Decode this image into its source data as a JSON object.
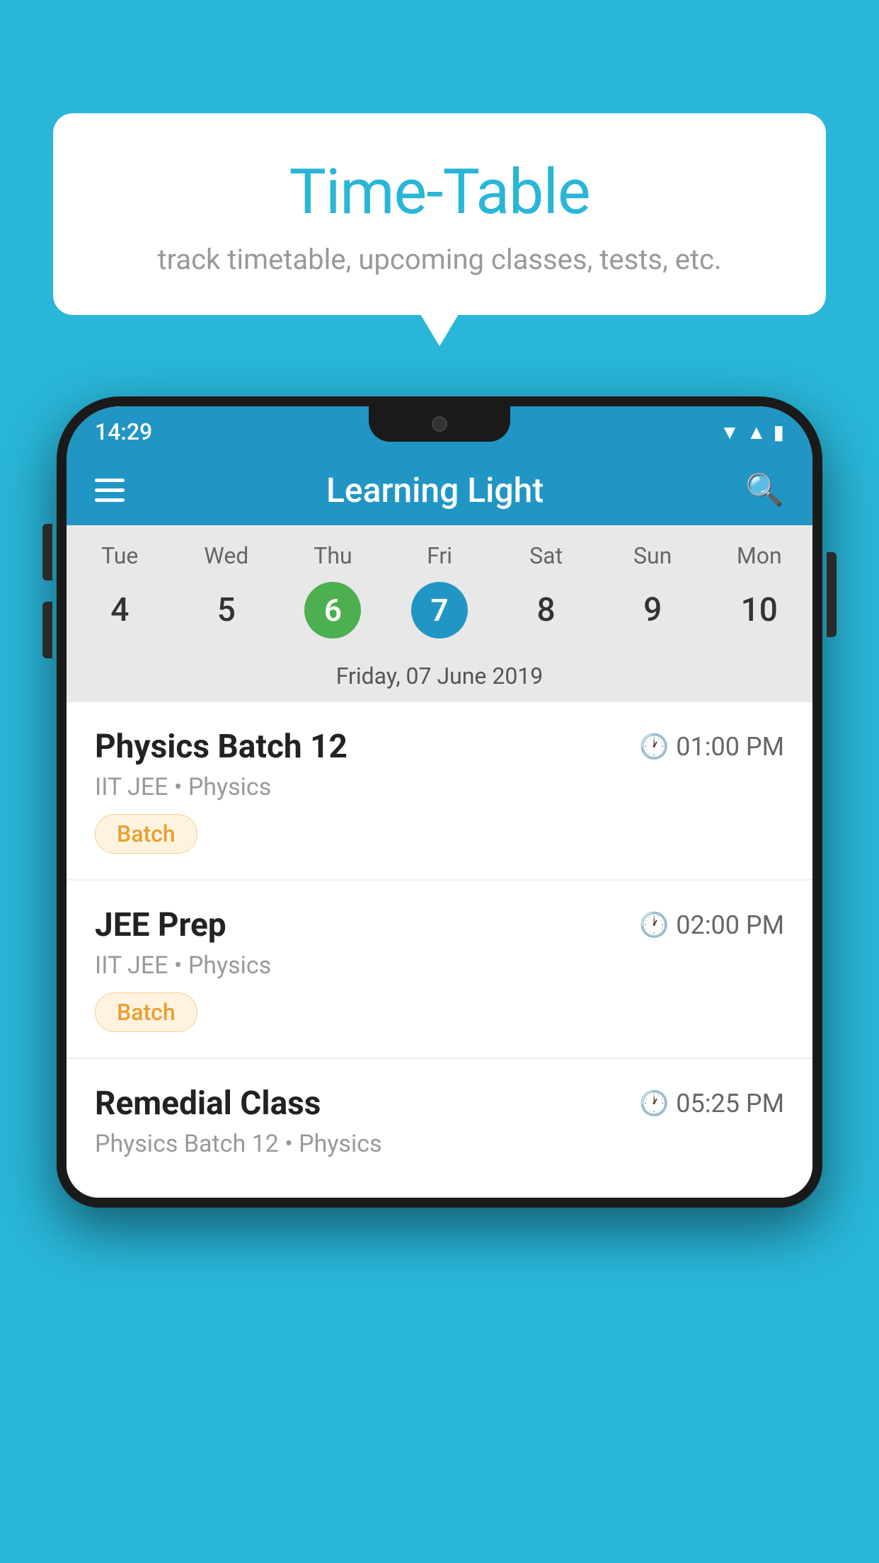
{
  "background_color": "#29b6d8",
  "tooltip": {
    "title": "Time-Table",
    "subtitle": "track timetable, upcoming classes, tests, etc."
  },
  "phone": {
    "status_bar": {
      "time": "14:29"
    },
    "header": {
      "app_name": "Learning Light"
    },
    "calendar": {
      "days": [
        {
          "label": "Tue",
          "num": "4",
          "state": "normal"
        },
        {
          "label": "Wed",
          "num": "5",
          "state": "normal"
        },
        {
          "label": "Thu",
          "num": "6",
          "state": "today"
        },
        {
          "label": "Fri",
          "num": "7",
          "state": "selected"
        },
        {
          "label": "Sat",
          "num": "8",
          "state": "normal"
        },
        {
          "label": "Sun",
          "num": "9",
          "state": "normal"
        },
        {
          "label": "Mon",
          "num": "10",
          "state": "normal"
        }
      ],
      "selected_date_label": "Friday, 07 June 2019"
    },
    "schedule": [
      {
        "title": "Physics Batch 12",
        "time": "01:00 PM",
        "sub": "IIT JEE • Physics",
        "badge": "Batch"
      },
      {
        "title": "JEE Prep",
        "time": "02:00 PM",
        "sub": "IIT JEE • Physics",
        "badge": "Batch"
      },
      {
        "title": "Remedial Class",
        "time": "05:25 PM",
        "sub": "Physics Batch 12 • Physics",
        "badge": null
      }
    ]
  }
}
